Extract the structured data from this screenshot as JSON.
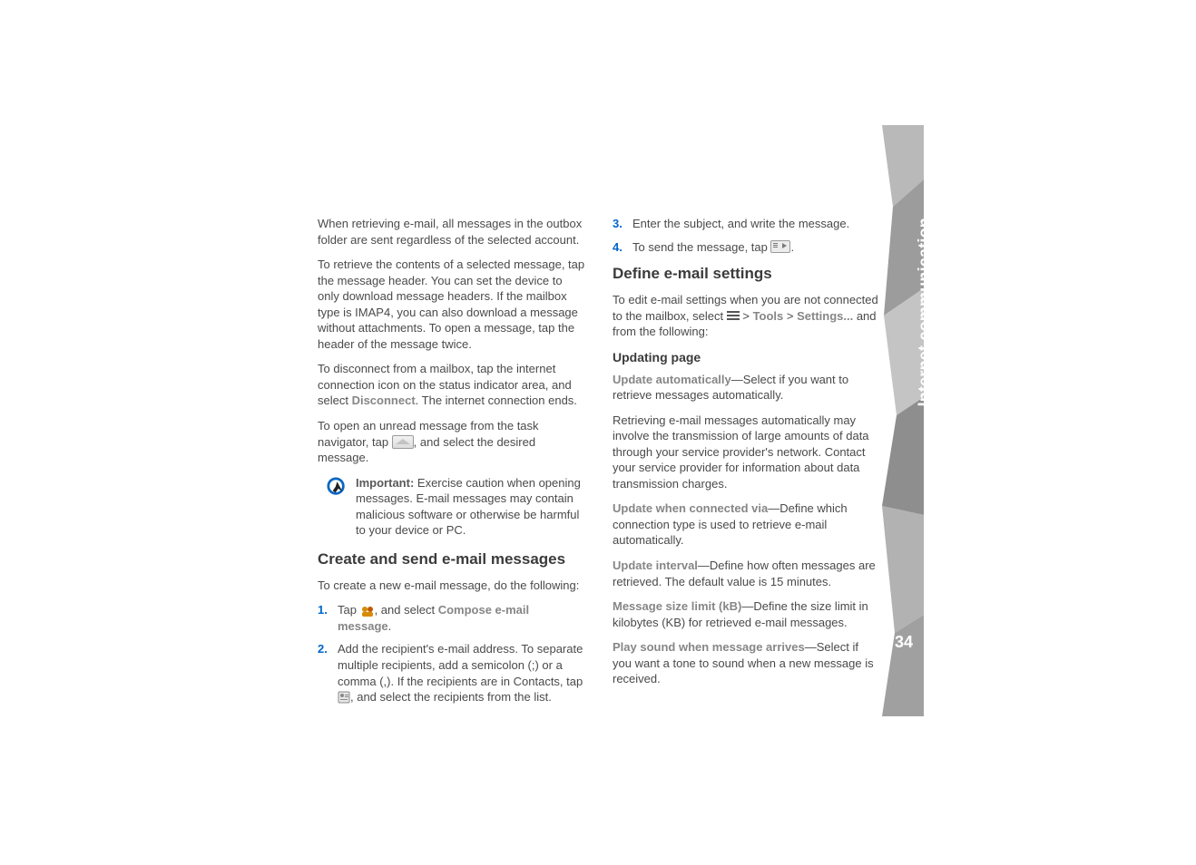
{
  "sidebar": {
    "section_title": "Internet communication",
    "page_number": "34"
  },
  "left": {
    "p1": "When retrieving e-mail, all messages in the outbox folder are sent regardless of the selected account.",
    "p2": "To retrieve the contents of a selected message, tap the message header. You can set the device to only download message headers. If the mailbox type is IMAP4, you can also download a message without attachments. To open a message, tap the header of the message twice.",
    "p3_a": "To disconnect from a mailbox, tap the internet connection icon on the status indicator area, and select ",
    "p3_disconnect": "Disconnect",
    "p3_b": ". The internet connection ends.",
    "p4_a": "To open an unread message from the task navigator, tap ",
    "p4_b": ", and select the desired message.",
    "important_label": "Important:",
    "important_text": " Exercise caution when opening messages. E-mail messages may contain malicious software or otherwise be harmful to your device or PC.",
    "h_create": "Create and send e-mail messages",
    "p_create_intro": "To create a new e-mail message, do the following:",
    "step1_a": "Tap ",
    "step1_b": ", and select ",
    "step1_compose": "Compose e-mail message",
    "step1_c": ".",
    "step2_a": "Add the recipient's e-mail address. To separate multiple recipients, add a semicolon (;) or a comma (,). If the recipients are in Contacts, tap ",
    "step2_b": ", and select the recipients from the list."
  },
  "right": {
    "step3": "Enter the subject, and write the message.",
    "step4_a": "To send the message, tap ",
    "step4_b": ".",
    "h_define": "Define e-mail settings",
    "p_define_a": "To edit e-mail settings when you are not connected to the mailbox, select ",
    "p_define_tools": "Tools",
    "p_define_settings": "Settings...",
    "p_define_b": " and from the following:",
    "h_updating": "Updating page",
    "opt1_label": "Update automatically",
    "opt1_text": "—Select if you want to retrieve messages automatically.",
    "p_retrieving": "Retrieving e-mail messages automatically may involve the transmission of large amounts of data through your service provider's network. Contact your service provider for information about data transmission charges.",
    "opt2_label": "Update when connected via",
    "opt2_text": "—Define which connection type is used to retrieve e-mail automatically.",
    "opt3_label": "Update interval",
    "opt3_text": "—Define how often messages are retrieved. The default value is 15 minutes.",
    "opt4_label": "Message size limit (kB)",
    "opt4_text": "—Define the size limit in kilobytes (KB) for retrieved e-mail messages.",
    "opt5_label": "Play sound when message arrives",
    "opt5_text": "—Select if you want a tone to sound when a new message is received."
  },
  "nums": {
    "n1": "1.",
    "n2": "2.",
    "n3": "3.",
    "n4": "4."
  }
}
